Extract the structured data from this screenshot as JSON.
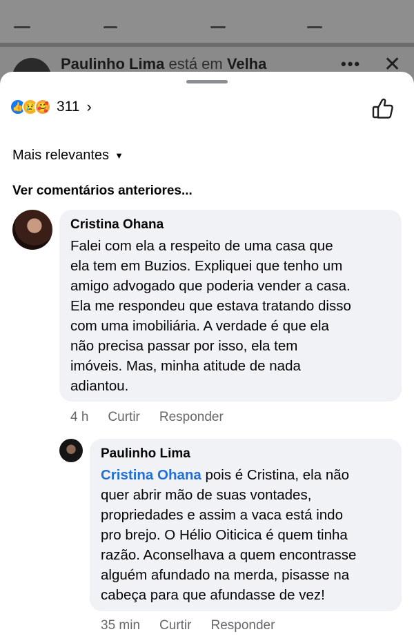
{
  "background": {
    "post_author": "Paulinho Lima",
    "post_connector": "está em",
    "post_location": "Velha",
    "more_icon": "dots-icon",
    "close_icon": "close-icon"
  },
  "reactions": {
    "icons": [
      "like-icon",
      "sad-icon",
      "care-icon"
    ],
    "count": "311",
    "chevron": "›"
  },
  "sort": {
    "label": "Mais relevantes"
  },
  "earlier_comments": {
    "label": "Ver comentários anteriores..."
  },
  "comments": [
    {
      "author": "Cristina Ohana",
      "text": "Falei com ela a respeito de uma casa que\nela tem em Buzios. Expliquei que tenho um\namigo advogado que poderia vender a casa.\nEla me respondeu que estava tratando disso\ncom uma imobiliária. A verdade é que ela\nnão precisa passar por isso, ela tem\nimóveis. Mas, minha atitude de nada\nadiantou.",
      "time": "4 h",
      "like_label": "Curtir",
      "reply_label": "Responder"
    },
    {
      "author": "Paulinho Lima",
      "mention": "Cristina Ohana",
      "text": " pois é Cristina, ela não\nquer abrir mão de suas vontades,\npropriedades e assim a vaca está indo\npro brejo. O Hélio Oiticica é quem tinha\nrazão. Aconselhava a quem encontrasse\nalguém afundado na merda, pisasse na\ncabeça para que afundasse de vez!",
      "time": "35 min",
      "like_label": "Curtir",
      "reply_label": "Responder"
    }
  ],
  "colors": {
    "mention": "#216fdb",
    "like_blue": "#1877f2",
    "bubble": "#f0f2f5",
    "meta_gray": "#65676b"
  }
}
